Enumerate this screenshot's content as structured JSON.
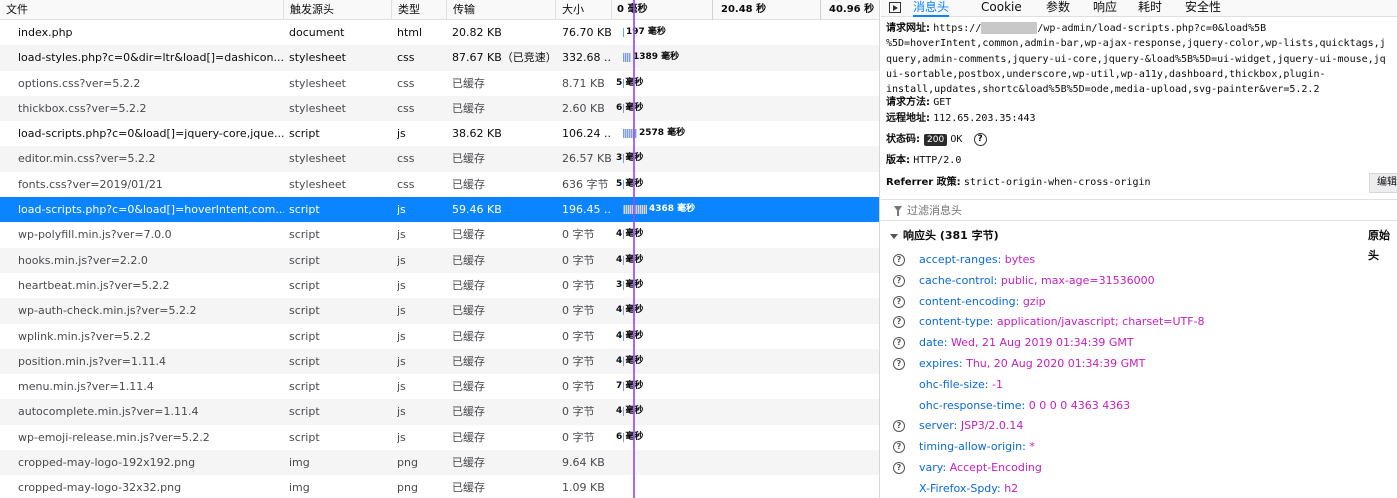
{
  "columns": {
    "file": "文件",
    "cause": "触发源头",
    "type": "类型",
    "transferred": "传输",
    "size": "大小",
    "t0": "0 毫秒",
    "t1": "20.48 秒",
    "t2": "40.96 秒"
  },
  "requests": [
    {
      "file": "index.php",
      "cause": "document",
      "type": "html",
      "transferred": "20.82 KB",
      "size": "76.70 KB",
      "timing": "197 毫秒",
      "bar_ms": 197,
      "dark": true
    },
    {
      "file": "load-styles.php?c=0&dir=ltr&load[]=dashicon...",
      "cause": "stylesheet",
      "type": "css",
      "transferred": "87.67 KB（已竞速）",
      "size": "332.68 ...",
      "timing": "1389 毫秒",
      "bar_ms": 1389,
      "dark": true
    },
    {
      "file": "options.css?ver=5.2.2",
      "cause": "stylesheet",
      "type": "css",
      "transferred": "已缓存",
      "size": "8.71 KB",
      "timing": "5 毫秒",
      "bar_ms": 5,
      "dark": false
    },
    {
      "file": "thickbox.css?ver=5.2.2",
      "cause": "stylesheet",
      "type": "css",
      "transferred": "已缓存",
      "size": "2.60 KB",
      "timing": "6 毫秒",
      "bar_ms": 6,
      "dark": false
    },
    {
      "file": "load-scripts.php?c=0&load[]=jquery-core,jque...",
      "cause": "script",
      "type": "js",
      "transferred": "38.62 KB",
      "size": "106.24 ...",
      "timing": "2578 毫秒",
      "bar_ms": 2578,
      "dark": true
    },
    {
      "file": "editor.min.css?ver=5.2.2",
      "cause": "stylesheet",
      "type": "css",
      "transferred": "已缓存",
      "size": "26.57 KB",
      "timing": "3 毫秒",
      "bar_ms": 3,
      "dark": false
    },
    {
      "file": "fonts.css?ver=2019/01/21",
      "cause": "stylesheet",
      "type": "css",
      "transferred": "已缓存",
      "size": "636 字节",
      "timing": "5 毫秒",
      "bar_ms": 5,
      "dark": false
    },
    {
      "file": "load-scripts.php?c=0&load[]=hoverIntent,com...",
      "cause": "script",
      "type": "js",
      "transferred": "59.46 KB",
      "size": "196.45 ...",
      "timing": "4368 毫秒",
      "bar_ms": 4368,
      "dark": true,
      "selected": true
    },
    {
      "file": "wp-polyfill.min.js?ver=7.0.0",
      "cause": "script",
      "type": "js",
      "transferred": "已缓存",
      "size": "0 字节",
      "timing": "4 毫秒",
      "bar_ms": 4,
      "dark": false
    },
    {
      "file": "hooks.min.js?ver=2.2.0",
      "cause": "script",
      "type": "js",
      "transferred": "已缓存",
      "size": "0 字节",
      "timing": "4 毫秒",
      "bar_ms": 4,
      "dark": false
    },
    {
      "file": "heartbeat.min.js?ver=5.2.2",
      "cause": "script",
      "type": "js",
      "transferred": "已缓存",
      "size": "0 字节",
      "timing": "3 毫秒",
      "bar_ms": 3,
      "dark": false
    },
    {
      "file": "wp-auth-check.min.js?ver=5.2.2",
      "cause": "script",
      "type": "js",
      "transferred": "已缓存",
      "size": "0 字节",
      "timing": "4 毫秒",
      "bar_ms": 4,
      "dark": false
    },
    {
      "file": "wplink.min.js?ver=5.2.2",
      "cause": "script",
      "type": "js",
      "transferred": "已缓存",
      "size": "0 字节",
      "timing": "4 毫秒",
      "bar_ms": 4,
      "dark": false
    },
    {
      "file": "position.min.js?ver=1.11.4",
      "cause": "script",
      "type": "js",
      "transferred": "已缓存",
      "size": "0 字节",
      "timing": "4 毫秒",
      "bar_ms": 4,
      "dark": false
    },
    {
      "file": "menu.min.js?ver=1.11.4",
      "cause": "script",
      "type": "js",
      "transferred": "已缓存",
      "size": "0 字节",
      "timing": "7 毫秒",
      "bar_ms": 7,
      "dark": false
    },
    {
      "file": "autocomplete.min.js?ver=1.11.4",
      "cause": "script",
      "type": "js",
      "transferred": "已缓存",
      "size": "0 字节",
      "timing": "4 毫秒",
      "bar_ms": 4,
      "dark": false
    },
    {
      "file": "wp-emoji-release.min.js?ver=5.2.2",
      "cause": "script",
      "type": "js",
      "transferred": "已缓存",
      "size": "0 字节",
      "timing": "6 毫秒",
      "bar_ms": 6,
      "dark": false
    },
    {
      "file": "cropped-may-logo-192x192.png",
      "cause": "img",
      "type": "png",
      "transferred": "已缓存",
      "size": "9.64 KB",
      "timing": "",
      "bar_ms": 0,
      "dark": false
    },
    {
      "file": "cropped-may-logo-32x32.png",
      "cause": "img",
      "type": "png",
      "transferred": "已缓存",
      "size": "1.09 KB",
      "timing": "",
      "bar_ms": 0,
      "dark": false
    }
  ],
  "tabs": [
    "消息头",
    "Cookie",
    "参数",
    "响应",
    "耗时",
    "安全性"
  ],
  "summary": {
    "url_label": "请求网址:",
    "url_lines": [
      "https://",
      "/wp-admin/load-scripts.php?c=0&load%5B",
      "%5D=hoverIntent,common,admin-bar,wp-ajax-response,jquery-color,wp-lists,quicktags,j",
      "query,admin-comments,jquery-ui-core,jquery-&load%5B%5D=ui-widget,jquery-ui-mouse,jq",
      "ui-sortable,postbox,underscore,wp-util,wp-a11y,dashboard,thickbox,plugin-",
      "install,updates,shortc&load%5B%5D=ode,media-upload,svg-painter&ver=5.2.2"
    ],
    "method_label": "请求方法:",
    "method": "GET",
    "remote_label": "远程地址:",
    "remote": "112.65.203.35:443",
    "status_label": "状态码:",
    "status_code": "200",
    "status_text": "OK",
    "version_label": "版本:",
    "version": "HTTP/2.0",
    "referrer_label": "Referrer 政策:",
    "referrer": "strict-origin-when-cross-origin",
    "edit_label": "编辑"
  },
  "filter": {
    "placeholder": "过滤消息头"
  },
  "response_headers": {
    "title": "响应头 (381 字节)",
    "raw_label": "原始头",
    "items": [
      {
        "key": "accept-ranges:",
        "value": "bytes",
        "help": true,
        "key_plain": false
      },
      {
        "key": "cache-control:",
        "value": "public, max-age=31536000",
        "help": true,
        "key_plain": false
      },
      {
        "key": "content-encoding:",
        "value": "gzip",
        "help": true,
        "key_plain": false
      },
      {
        "key": "content-type:",
        "value": "application/javascript; charset=UTF-8",
        "help": true,
        "key_plain": false
      },
      {
        "key": "date:",
        "value": "Wed, 21 Aug 2019 01:34:39 GMT",
        "help": true,
        "key_plain": false
      },
      {
        "key": "expires:",
        "value": "Thu, 20 Aug 2020 01:34:39 GMT",
        "help": true,
        "key_plain": false
      },
      {
        "key": "ohc-file-size:",
        "value": "-1",
        "help": false,
        "key_plain": false
      },
      {
        "key": "ohc-response-time:",
        "value": "0 0 0 0 4363 4363",
        "help": false,
        "key_plain": false
      },
      {
        "key": "server:",
        "value": "JSP3/2.0.14",
        "help": true,
        "key_plain": false
      },
      {
        "key": "timing-allow-origin:",
        "value": "*",
        "help": true,
        "key_plain": false
      },
      {
        "key": "vary:",
        "value": "Accept-Encoding",
        "help": true,
        "key_plain": false
      },
      {
        "key": "X-Firefox-Spdy:",
        "value": "h2",
        "help": false,
        "key_plain": false
      }
    ]
  },
  "colors": {
    "selection": "#0a84ff",
    "header_key": "#0a69d6",
    "header_value": "#c51ec1",
    "timeline_marker": "#9b4cff"
  }
}
